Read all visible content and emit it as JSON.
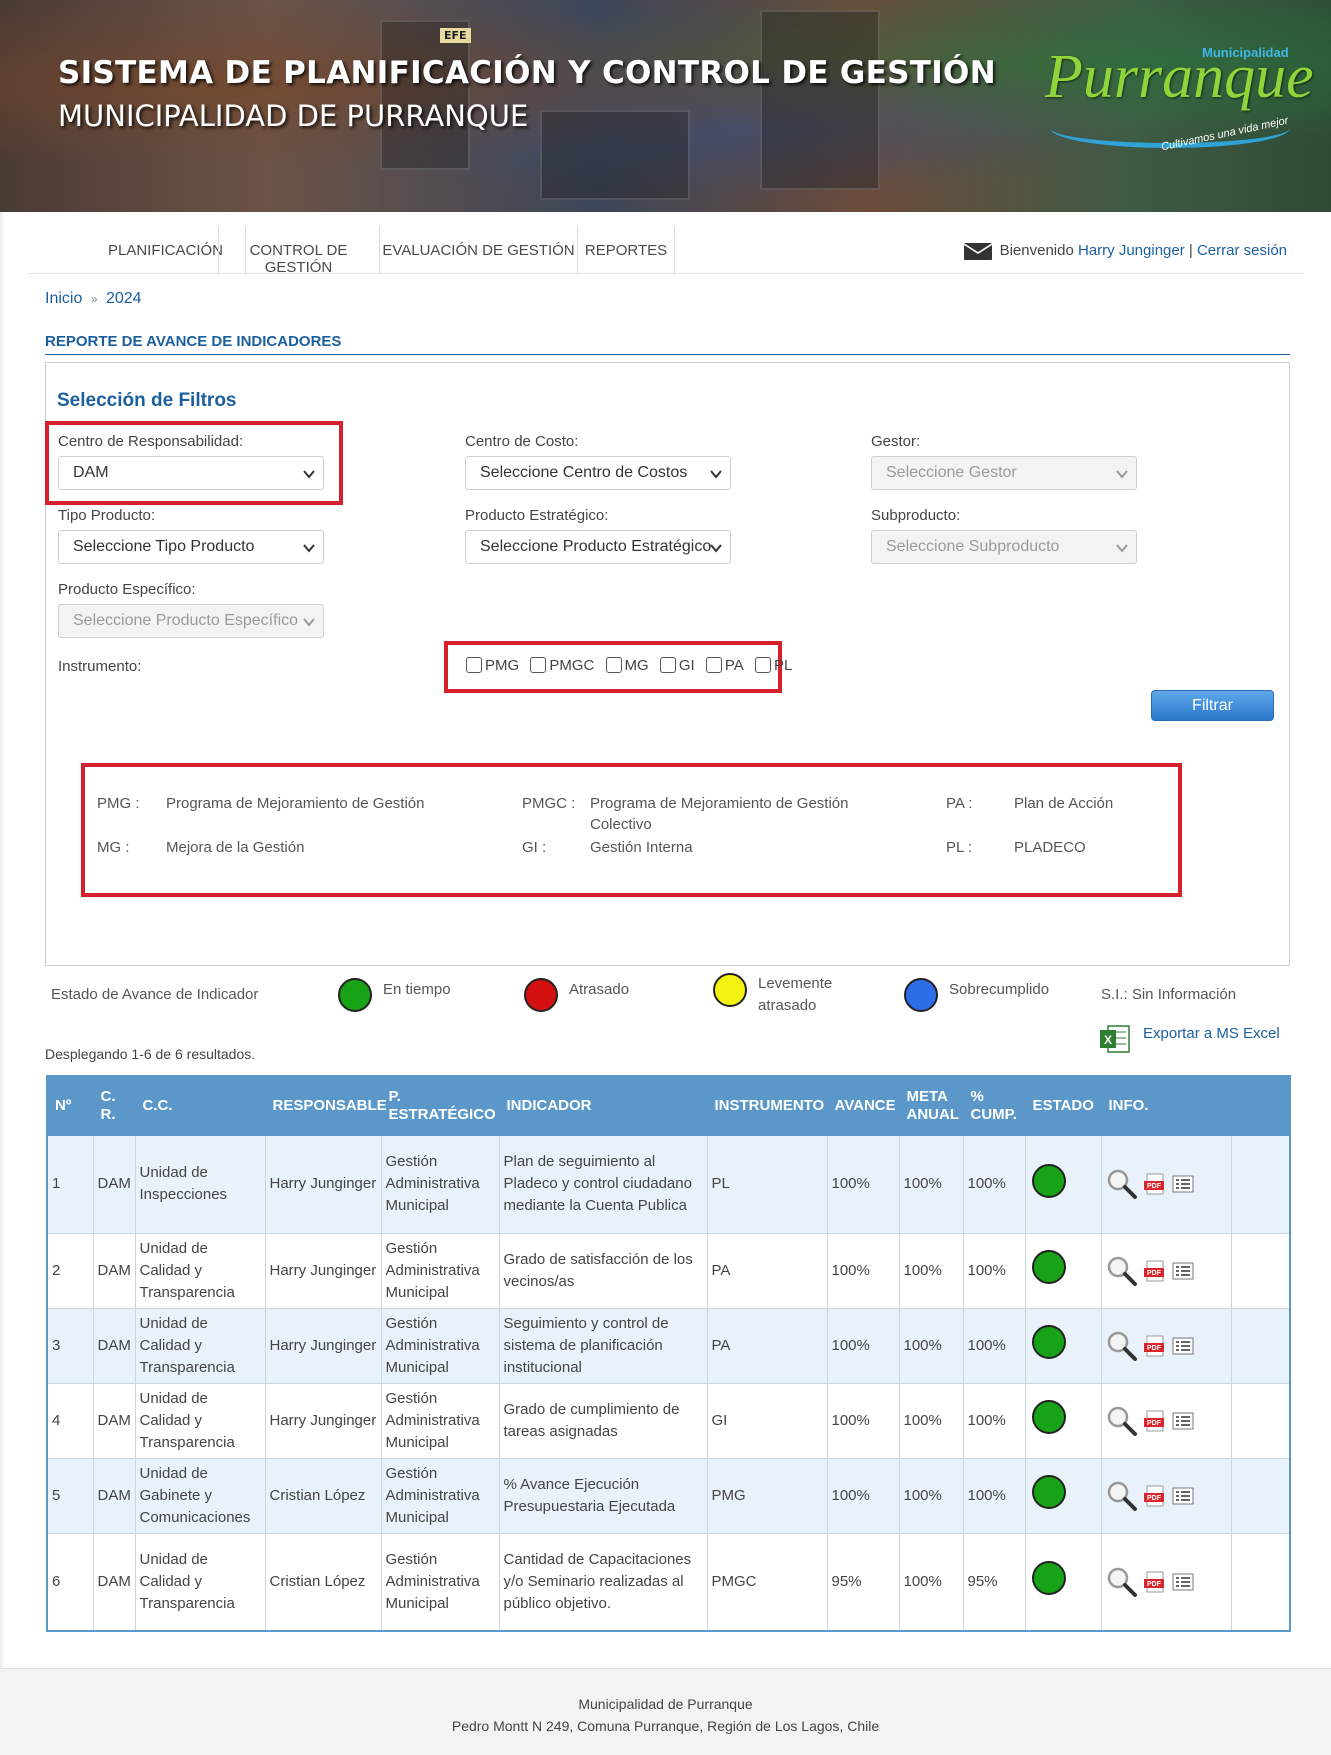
{
  "header": {
    "title": "SISTEMA DE PLANIFICACIÓN Y CONTROL DE GESTIÓN",
    "subtitle": "MUNICIPALIDAD DE PURRANQUE",
    "logo_small": "Municipalidad",
    "logo_big": "Purranque",
    "logo_slogan": "Cultivamos una vida mejor",
    "banner_sign": "EFE"
  },
  "nav": {
    "items": [
      "PLANIFICACIÓN",
      "CONTROL DE GESTIÓN",
      "EVALUACIÓN DE GESTIÓN",
      "REPORTES"
    ],
    "welcome": "Bienvenido",
    "user": "Harry Junginger",
    "separator": "|",
    "logout": "Cerrar sesión"
  },
  "breadcrumb": {
    "home": "Inicio",
    "sep": "»",
    "year": "2024"
  },
  "section_title": "REPORTE DE AVANCE DE INDICADORES",
  "filters": {
    "heading": "Selección de Filtros",
    "centro_responsabilidad": {
      "label": "Centro de Responsabilidad:",
      "value": "DAM"
    },
    "centro_costo": {
      "label": "Centro de Costo:",
      "value": "Seleccione Centro de Costos"
    },
    "gestor": {
      "label": "Gestor:",
      "value": "Seleccione Gestor"
    },
    "tipo_producto": {
      "label": "Tipo Producto:",
      "value": "Seleccione Tipo Producto"
    },
    "producto_estrategico": {
      "label": "Producto Estratégico:",
      "value": "Seleccione Producto Estratégico"
    },
    "subproducto": {
      "label": "Subproducto:",
      "value": "Seleccione Subproducto"
    },
    "producto_especifico": {
      "label": "Producto Específico:",
      "value": "Seleccione Producto Específico"
    },
    "instrumento": {
      "label": "Instrumento:",
      "options": [
        "PMG",
        "PMGC",
        "MG",
        "GI",
        "PA",
        "PL"
      ]
    },
    "button": "Filtrar"
  },
  "instrument_legend": {
    "pmg_code": "PMG :",
    "pmg_desc": "Programa de Mejoramiento de Gestión",
    "pmgc_code": "PMGC :",
    "pmgc_desc": "Programa de Mejoramiento de Gestión Colectivo",
    "pa_code": "PA :",
    "pa_desc": "Plan de Acción",
    "mg_code": "MG :",
    "mg_desc": "Mejora de la Gestión",
    "gi_code": "GI :",
    "gi_desc": "Gestión Interna",
    "pl_code": "PL :",
    "pl_desc": "PLADECO"
  },
  "status_legend": {
    "label": "Estado de Avance de Indicador",
    "en_tiempo": "En tiempo",
    "atrasado": "Atrasado",
    "levemente": "Levemente atrasado",
    "sobrecumplido": "Sobrecumplido",
    "si": "S.I.: Sin Información",
    "colors": {
      "en_tiempo": "#17a217",
      "atrasado": "#d40f0f",
      "levemente": "#f4f211",
      "sobrecumplido": "#2d6ee8"
    }
  },
  "export_label": "Exportar a MS Excel",
  "results_label": "Desplegando 1-6 de 6 resultados.",
  "table": {
    "headers": {
      "n": "Nº",
      "cr": "C. R.",
      "cc": "C.C.",
      "responsable": "RESPONSABLE",
      "pe": "P. ESTRATÉGICO",
      "indicador": "INDICADOR",
      "instrumento": "INSTRUMENTO",
      "avance": "AVANCE",
      "meta": "META ANUAL",
      "cump": "% CUMP.",
      "estado": "ESTADO",
      "info": "INFO."
    },
    "rows": [
      {
        "n": "1",
        "cr": "DAM",
        "cc": "Unidad de Inspecciones",
        "responsable": "Harry Junginger",
        "pe": "Gestión Administrativa Municipal",
        "indicador": "Plan de seguimiento al Pladeco y control ciudadano mediante la Cuenta Publica",
        "instrumento": "PL",
        "avance": "100%",
        "meta": "100%",
        "cump": "100%"
      },
      {
        "n": "2",
        "cr": "DAM",
        "cc": "Unidad de Calidad y Transparencia",
        "responsable": "Harry Junginger",
        "pe": "Gestión Administrativa Municipal",
        "indicador": "Grado de satisfacción de los vecinos/as",
        "instrumento": "PA",
        "avance": "100%",
        "meta": "100%",
        "cump": "100%"
      },
      {
        "n": "3",
        "cr": "DAM",
        "cc": "Unidad de Calidad y Transparencia",
        "responsable": "Harry Junginger",
        "pe": "Gestión Administrativa Municipal",
        "indicador": "Seguimiento y control de sistema de planificación institucional",
        "instrumento": "PA",
        "avance": "100%",
        "meta": "100%",
        "cump": "100%"
      },
      {
        "n": "4",
        "cr": "DAM",
        "cc": "Unidad de Calidad y Transparencia",
        "responsable": "Harry Junginger",
        "pe": "Gestión Administrativa Municipal",
        "indicador": "Grado de cumplimiento de tareas asignadas",
        "instrumento": "GI",
        "avance": "100%",
        "meta": "100%",
        "cump": "100%"
      },
      {
        "n": "5",
        "cr": "DAM",
        "cc": "Unidad de Gabinete y Comunicaciones",
        "responsable": "Cristian López",
        "pe": "Gestión Administrativa Municipal",
        "indicador": "% Avance Ejecución Presupuestaria Ejecutada",
        "instrumento": "PMG",
        "avance": "100%",
        "meta": "100%",
        "cump": "100%"
      },
      {
        "n": "6",
        "cr": "DAM",
        "cc": "Unidad de Calidad y Transparencia",
        "responsable": "Cristian López",
        "pe": "Gestión Administrativa Municipal",
        "indicador": "Cantidad de Capacitaciones y/o Seminario realizadas al público objetivo.",
        "instrumento": "PMGC",
        "avance": "95%",
        "meta": "100%",
        "cump": "95%"
      }
    ]
  },
  "footer": {
    "line1": "Municipalidad de Purranque",
    "line2": "Pedro Montt N 249, Comuna Purranque, Región de Los Lagos, Chile"
  }
}
